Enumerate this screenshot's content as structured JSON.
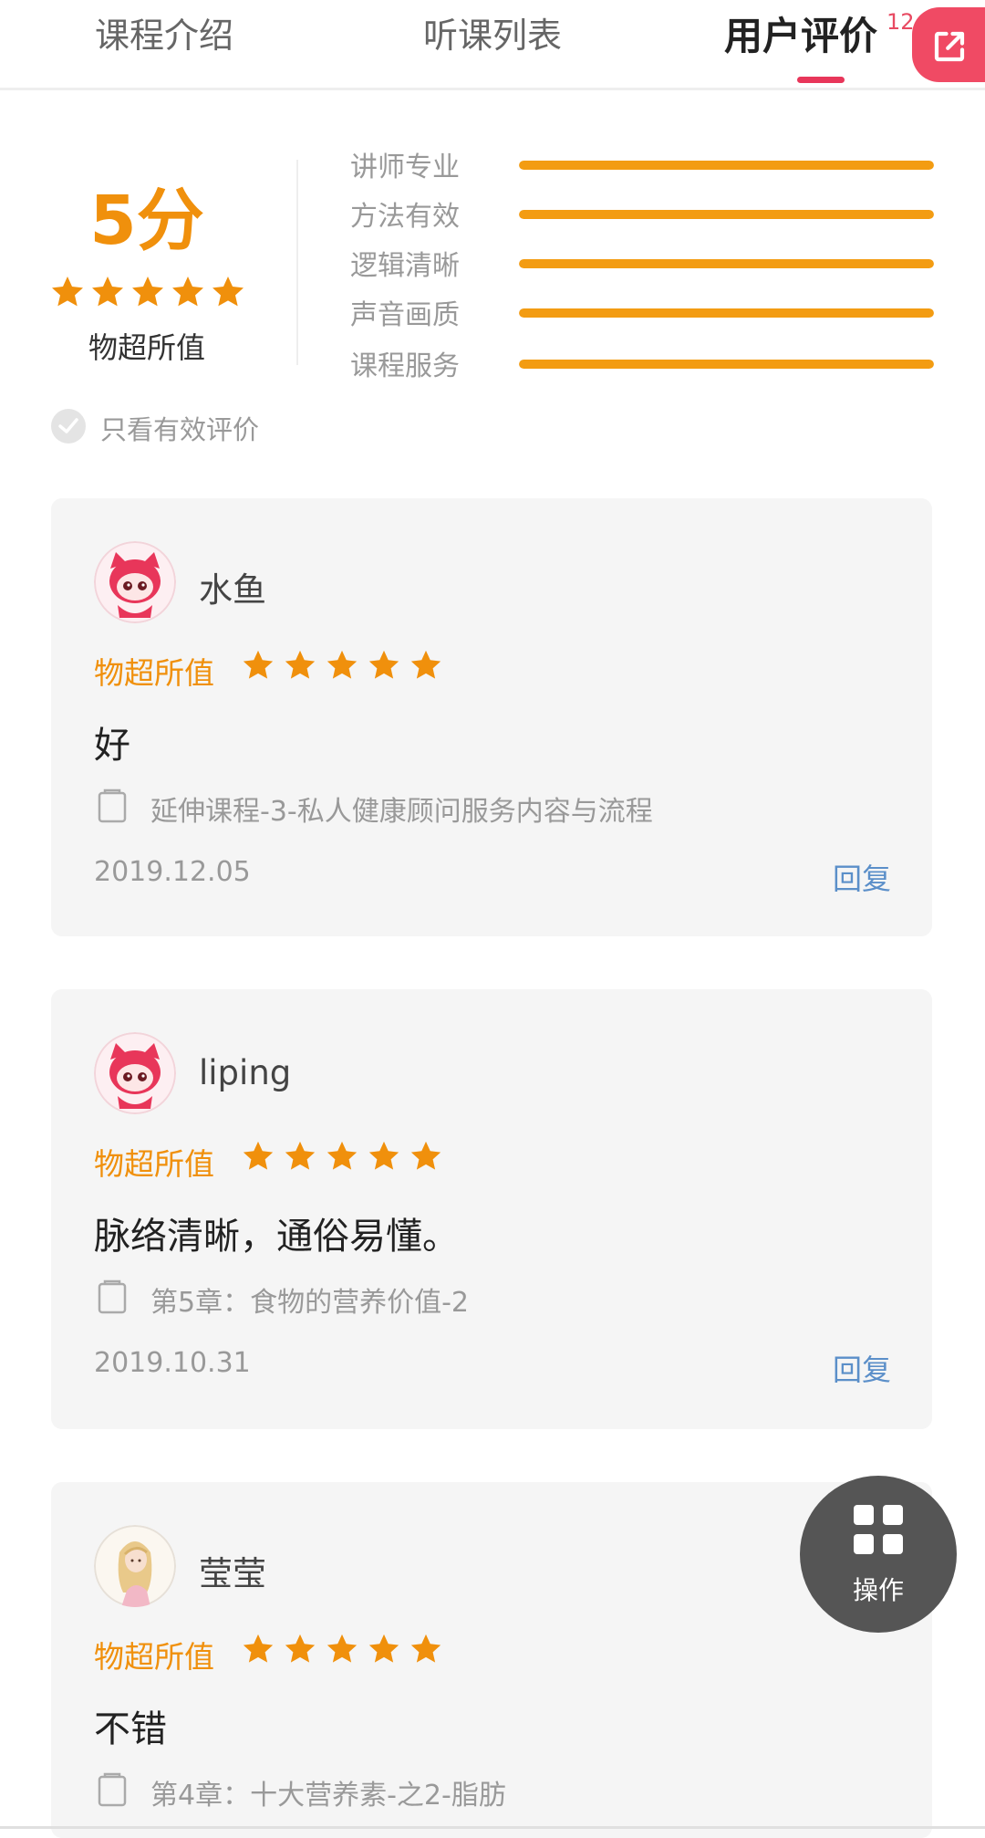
{
  "tabs": [
    {
      "label": "课程介绍"
    },
    {
      "label": "听课列表"
    },
    {
      "label": "用户评价",
      "badge": "12"
    }
  ],
  "icons": {
    "share": "external-link-icon",
    "check": "check-icon",
    "document": "document-icon",
    "grid": "grid-icon"
  },
  "summary": {
    "score": "5分",
    "stars": 5,
    "label": "物超所值",
    "ratings": [
      {
        "label": "讲师专业",
        "value": 1.0
      },
      {
        "label": "方法有效",
        "value": 1.0
      },
      {
        "label": "逻辑清晰",
        "value": 1.0
      },
      {
        "label": "声音画质",
        "value": 1.0
      },
      {
        "label": "课程服务",
        "value": 1.0
      }
    ]
  },
  "filter": {
    "label": "只看有效评价"
  },
  "reviews": [
    {
      "username": "水鱼",
      "tag": "物超所值",
      "stars": 5,
      "text": "好",
      "course": "延伸课程-3-私人健康顾问服务内容与流程",
      "date": "2019.12.05",
      "reply": "回复"
    },
    {
      "username": "liping",
      "tag": "物超所值",
      "stars": 5,
      "text": "脉络清晰，通俗易懂。",
      "course": "第5章：食物的营养价值-2",
      "date": "2019.10.31",
      "reply": "回复"
    },
    {
      "username": "莹莹",
      "tag": "物超所值",
      "stars": 5,
      "text": "不错",
      "course": "第4章：十大营养素-之2-脂肪"
    }
  ],
  "fab": {
    "label": "操作"
  },
  "colors": {
    "accent": "#f0900c",
    "tab_underline": "#e8365a",
    "share_bg": "#f04a64",
    "reply": "#5b8fc9",
    "card_bg": "#f5f5f5"
  }
}
